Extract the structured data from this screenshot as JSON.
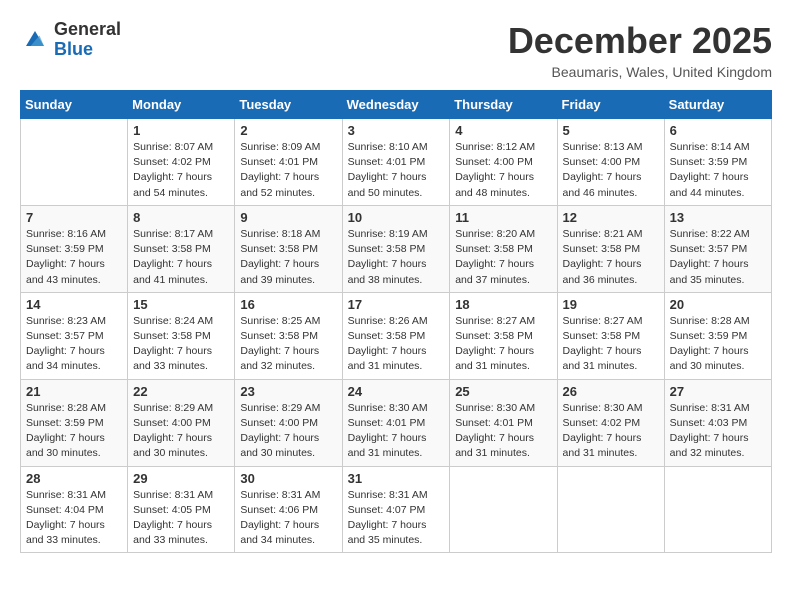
{
  "header": {
    "logo_general": "General",
    "logo_blue": "Blue",
    "month_title": "December 2025",
    "location": "Beaumaris, Wales, United Kingdom"
  },
  "calendar": {
    "days_of_week": [
      "Sunday",
      "Monday",
      "Tuesday",
      "Wednesday",
      "Thursday",
      "Friday",
      "Saturday"
    ],
    "weeks": [
      [
        {
          "day": "",
          "info": ""
        },
        {
          "day": "1",
          "info": "Sunrise: 8:07 AM\nSunset: 4:02 PM\nDaylight: 7 hours\nand 54 minutes."
        },
        {
          "day": "2",
          "info": "Sunrise: 8:09 AM\nSunset: 4:01 PM\nDaylight: 7 hours\nand 52 minutes."
        },
        {
          "day": "3",
          "info": "Sunrise: 8:10 AM\nSunset: 4:01 PM\nDaylight: 7 hours\nand 50 minutes."
        },
        {
          "day": "4",
          "info": "Sunrise: 8:12 AM\nSunset: 4:00 PM\nDaylight: 7 hours\nand 48 minutes."
        },
        {
          "day": "5",
          "info": "Sunrise: 8:13 AM\nSunset: 4:00 PM\nDaylight: 7 hours\nand 46 minutes."
        },
        {
          "day": "6",
          "info": "Sunrise: 8:14 AM\nSunset: 3:59 PM\nDaylight: 7 hours\nand 44 minutes."
        }
      ],
      [
        {
          "day": "7",
          "info": "Sunrise: 8:16 AM\nSunset: 3:59 PM\nDaylight: 7 hours\nand 43 minutes."
        },
        {
          "day": "8",
          "info": "Sunrise: 8:17 AM\nSunset: 3:58 PM\nDaylight: 7 hours\nand 41 minutes."
        },
        {
          "day": "9",
          "info": "Sunrise: 8:18 AM\nSunset: 3:58 PM\nDaylight: 7 hours\nand 39 minutes."
        },
        {
          "day": "10",
          "info": "Sunrise: 8:19 AM\nSunset: 3:58 PM\nDaylight: 7 hours\nand 38 minutes."
        },
        {
          "day": "11",
          "info": "Sunrise: 8:20 AM\nSunset: 3:58 PM\nDaylight: 7 hours\nand 37 minutes."
        },
        {
          "day": "12",
          "info": "Sunrise: 8:21 AM\nSunset: 3:58 PM\nDaylight: 7 hours\nand 36 minutes."
        },
        {
          "day": "13",
          "info": "Sunrise: 8:22 AM\nSunset: 3:57 PM\nDaylight: 7 hours\nand 35 minutes."
        }
      ],
      [
        {
          "day": "14",
          "info": "Sunrise: 8:23 AM\nSunset: 3:57 PM\nDaylight: 7 hours\nand 34 minutes."
        },
        {
          "day": "15",
          "info": "Sunrise: 8:24 AM\nSunset: 3:58 PM\nDaylight: 7 hours\nand 33 minutes."
        },
        {
          "day": "16",
          "info": "Sunrise: 8:25 AM\nSunset: 3:58 PM\nDaylight: 7 hours\nand 32 minutes."
        },
        {
          "day": "17",
          "info": "Sunrise: 8:26 AM\nSunset: 3:58 PM\nDaylight: 7 hours\nand 31 minutes."
        },
        {
          "day": "18",
          "info": "Sunrise: 8:27 AM\nSunset: 3:58 PM\nDaylight: 7 hours\nand 31 minutes."
        },
        {
          "day": "19",
          "info": "Sunrise: 8:27 AM\nSunset: 3:58 PM\nDaylight: 7 hours\nand 31 minutes."
        },
        {
          "day": "20",
          "info": "Sunrise: 8:28 AM\nSunset: 3:59 PM\nDaylight: 7 hours\nand 30 minutes."
        }
      ],
      [
        {
          "day": "21",
          "info": "Sunrise: 8:28 AM\nSunset: 3:59 PM\nDaylight: 7 hours\nand 30 minutes."
        },
        {
          "day": "22",
          "info": "Sunrise: 8:29 AM\nSunset: 4:00 PM\nDaylight: 7 hours\nand 30 minutes."
        },
        {
          "day": "23",
          "info": "Sunrise: 8:29 AM\nSunset: 4:00 PM\nDaylight: 7 hours\nand 30 minutes."
        },
        {
          "day": "24",
          "info": "Sunrise: 8:30 AM\nSunset: 4:01 PM\nDaylight: 7 hours\nand 31 minutes."
        },
        {
          "day": "25",
          "info": "Sunrise: 8:30 AM\nSunset: 4:01 PM\nDaylight: 7 hours\nand 31 minutes."
        },
        {
          "day": "26",
          "info": "Sunrise: 8:30 AM\nSunset: 4:02 PM\nDaylight: 7 hours\nand 31 minutes."
        },
        {
          "day": "27",
          "info": "Sunrise: 8:31 AM\nSunset: 4:03 PM\nDaylight: 7 hours\nand 32 minutes."
        }
      ],
      [
        {
          "day": "28",
          "info": "Sunrise: 8:31 AM\nSunset: 4:04 PM\nDaylight: 7 hours\nand 33 minutes."
        },
        {
          "day": "29",
          "info": "Sunrise: 8:31 AM\nSunset: 4:05 PM\nDaylight: 7 hours\nand 33 minutes."
        },
        {
          "day": "30",
          "info": "Sunrise: 8:31 AM\nSunset: 4:06 PM\nDaylight: 7 hours\nand 34 minutes."
        },
        {
          "day": "31",
          "info": "Sunrise: 8:31 AM\nSunset: 4:07 PM\nDaylight: 7 hours\nand 35 minutes."
        },
        {
          "day": "",
          "info": ""
        },
        {
          "day": "",
          "info": ""
        },
        {
          "day": "",
          "info": ""
        }
      ]
    ]
  }
}
